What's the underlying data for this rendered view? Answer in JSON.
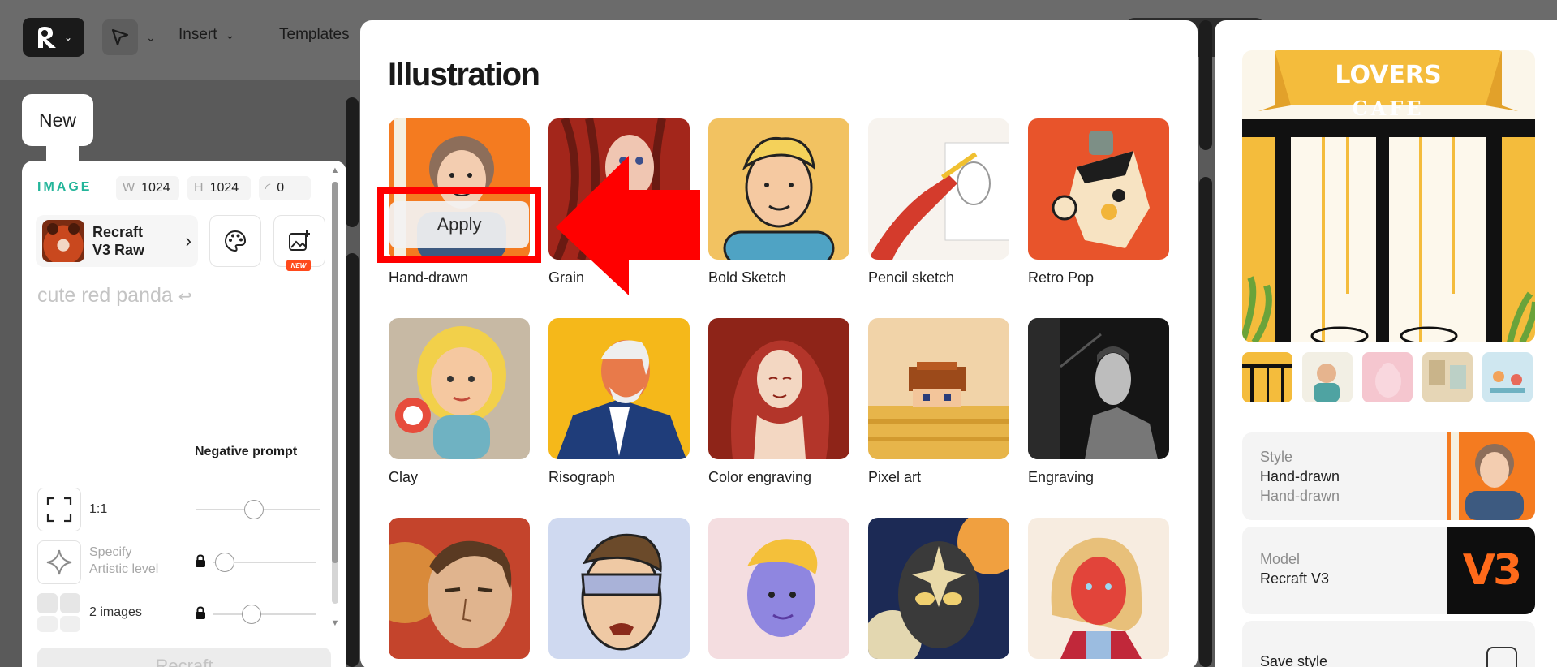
{
  "topbar": {
    "menu": [
      {
        "label": "Insert"
      },
      {
        "label": "Templates"
      }
    ]
  },
  "left_panel": {
    "new_label": "New",
    "section_label": "IMAGE",
    "width": {
      "key": "W",
      "value": "1024"
    },
    "height": {
      "key": "H",
      "value": "1024"
    },
    "corner": {
      "key": "◜",
      "value": "0"
    },
    "model": {
      "line1": "Recraft",
      "line2": "V3 Raw"
    },
    "new_badge": "NEW",
    "prompt_text": "cute red panda",
    "negative_prompt_label": "Negative prompt",
    "aspect_label": "1:1",
    "artistic_label_1": "Specify",
    "artistic_label_2": "Artistic level",
    "images_label": "2 images",
    "generate_button": "Recraft"
  },
  "modal": {
    "title": "Illustration",
    "apply_label": "Apply",
    "styles": [
      {
        "label": "Hand-drawn"
      },
      {
        "label": "Grain"
      },
      {
        "label": "Bold Sketch"
      },
      {
        "label": "Pencil sketch"
      },
      {
        "label": "Retro Pop"
      },
      {
        "label": "Clay"
      },
      {
        "label": "Risograph"
      },
      {
        "label": "Color engraving"
      },
      {
        "label": "Pixel art"
      },
      {
        "label": "Engraving"
      }
    ]
  },
  "right_panel": {
    "hero_sign_line1": "LOVERS",
    "hero_sign_line2": "CAFE",
    "style_card": {
      "key": "Style",
      "value": "Hand-drawn",
      "sub": "Hand-drawn"
    },
    "model_card": {
      "key": "Model",
      "value": "Recraft V3",
      "badge": "V3"
    },
    "save_card": {
      "value": "Save style"
    }
  }
}
